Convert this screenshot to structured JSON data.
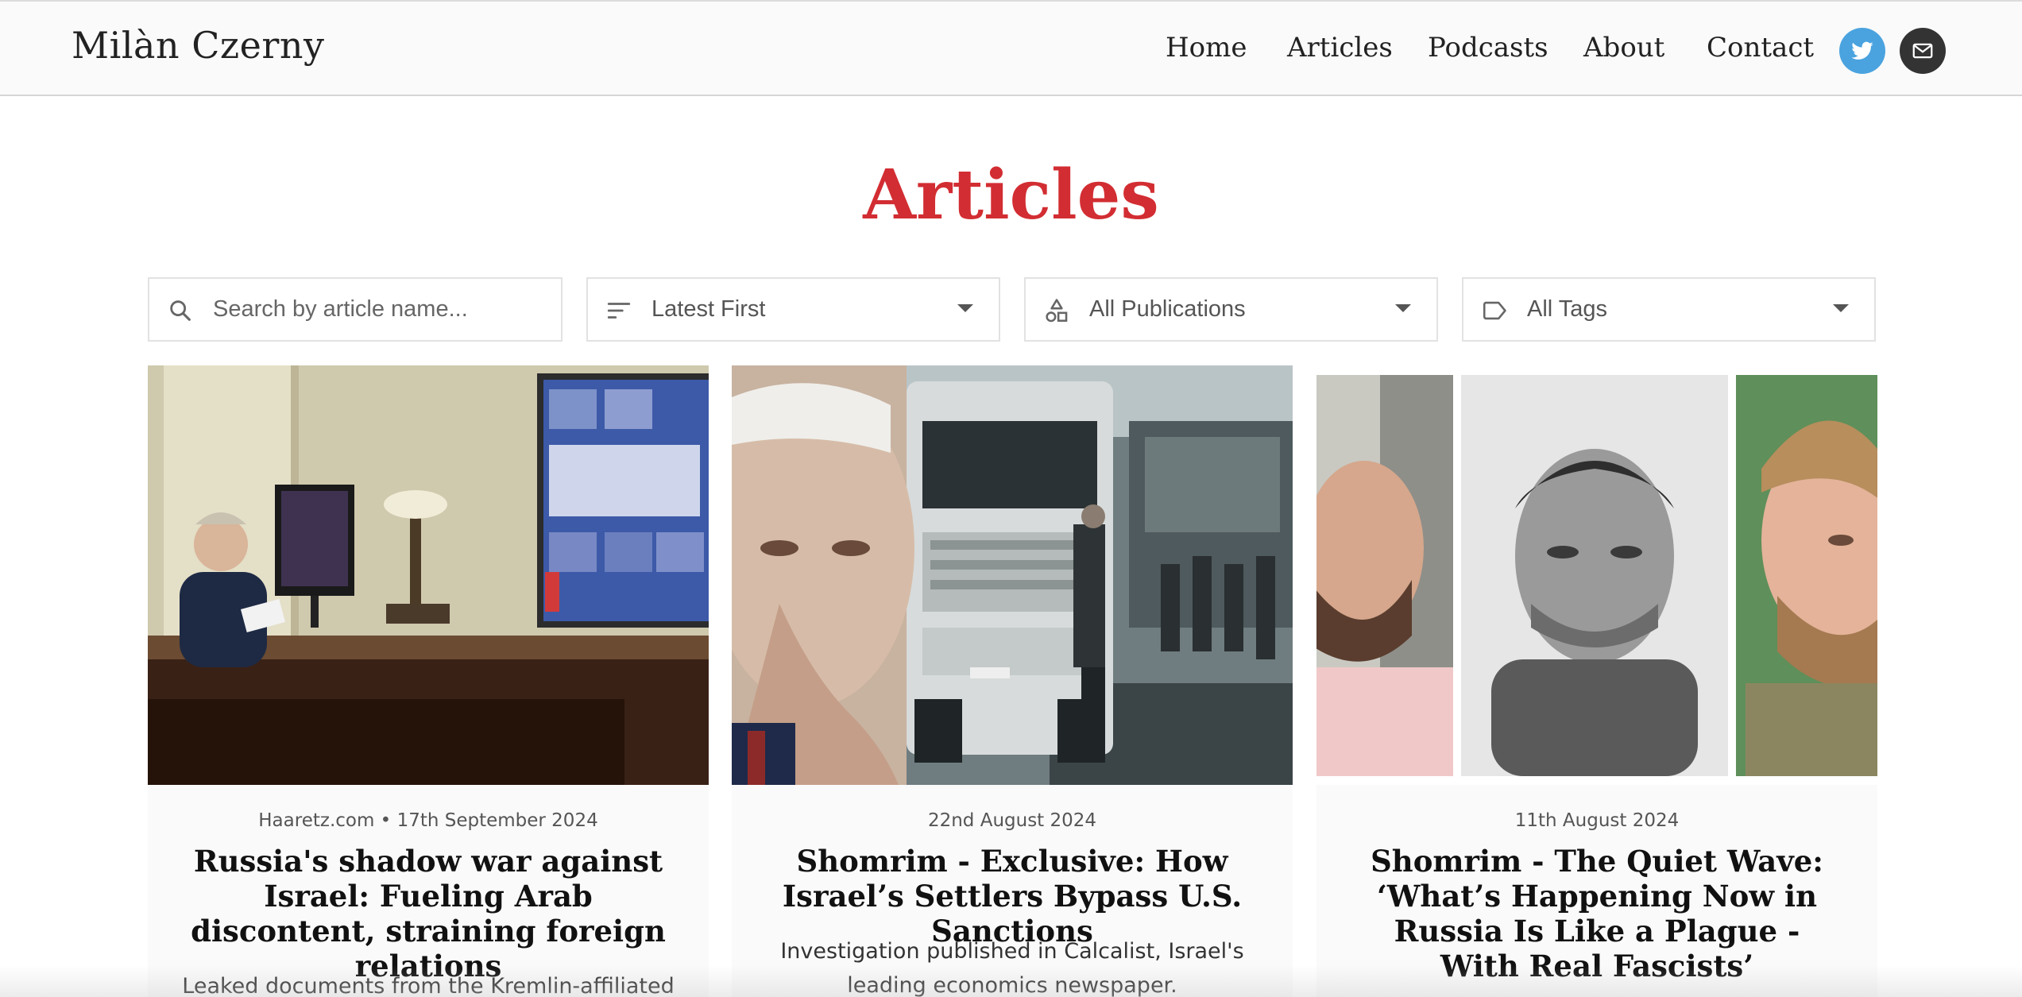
{
  "site": {
    "brand": "Milàn Czerny"
  },
  "nav": {
    "items": [
      {
        "label": "Home"
      },
      {
        "label": "Articles"
      },
      {
        "label": "Podcasts"
      },
      {
        "label": "About"
      },
      {
        "label": "Contact"
      }
    ],
    "social": [
      {
        "icon": "twitter-icon",
        "color": "#4aa3df"
      },
      {
        "icon": "mail-icon",
        "color": "#333333"
      }
    ]
  },
  "page": {
    "title": "Articles",
    "title_color": "#d22d32"
  },
  "filters": {
    "search": {
      "placeholder": "Search by article name...",
      "value": ""
    },
    "sort": {
      "selected": "Latest First"
    },
    "publication": {
      "selected": "All Publications"
    },
    "tags": {
      "selected": "All Tags"
    }
  },
  "articles": [
    {
      "meta": "Haaretz.com • 17th September 2024",
      "title": "Russia's shadow war against Israel: Fueling Arab discontent, straining foreign relations",
      "excerpt": "Leaked documents from the Kremlin-affiliated"
    },
    {
      "meta": "22nd August 2024",
      "title": "Shomrim - Exclusive: How Israel’s Settlers Bypass U.S. Sanctions",
      "excerpt": "Investigation published in Calcalist, Israel's leading economics newspaper."
    },
    {
      "meta": "11th August 2024",
      "title": "Shomrim - The Quiet Wave: ‘What’s Happening Now in Russia Is Like a Plague - With Real Fascists’",
      "excerpt": ""
    }
  ]
}
